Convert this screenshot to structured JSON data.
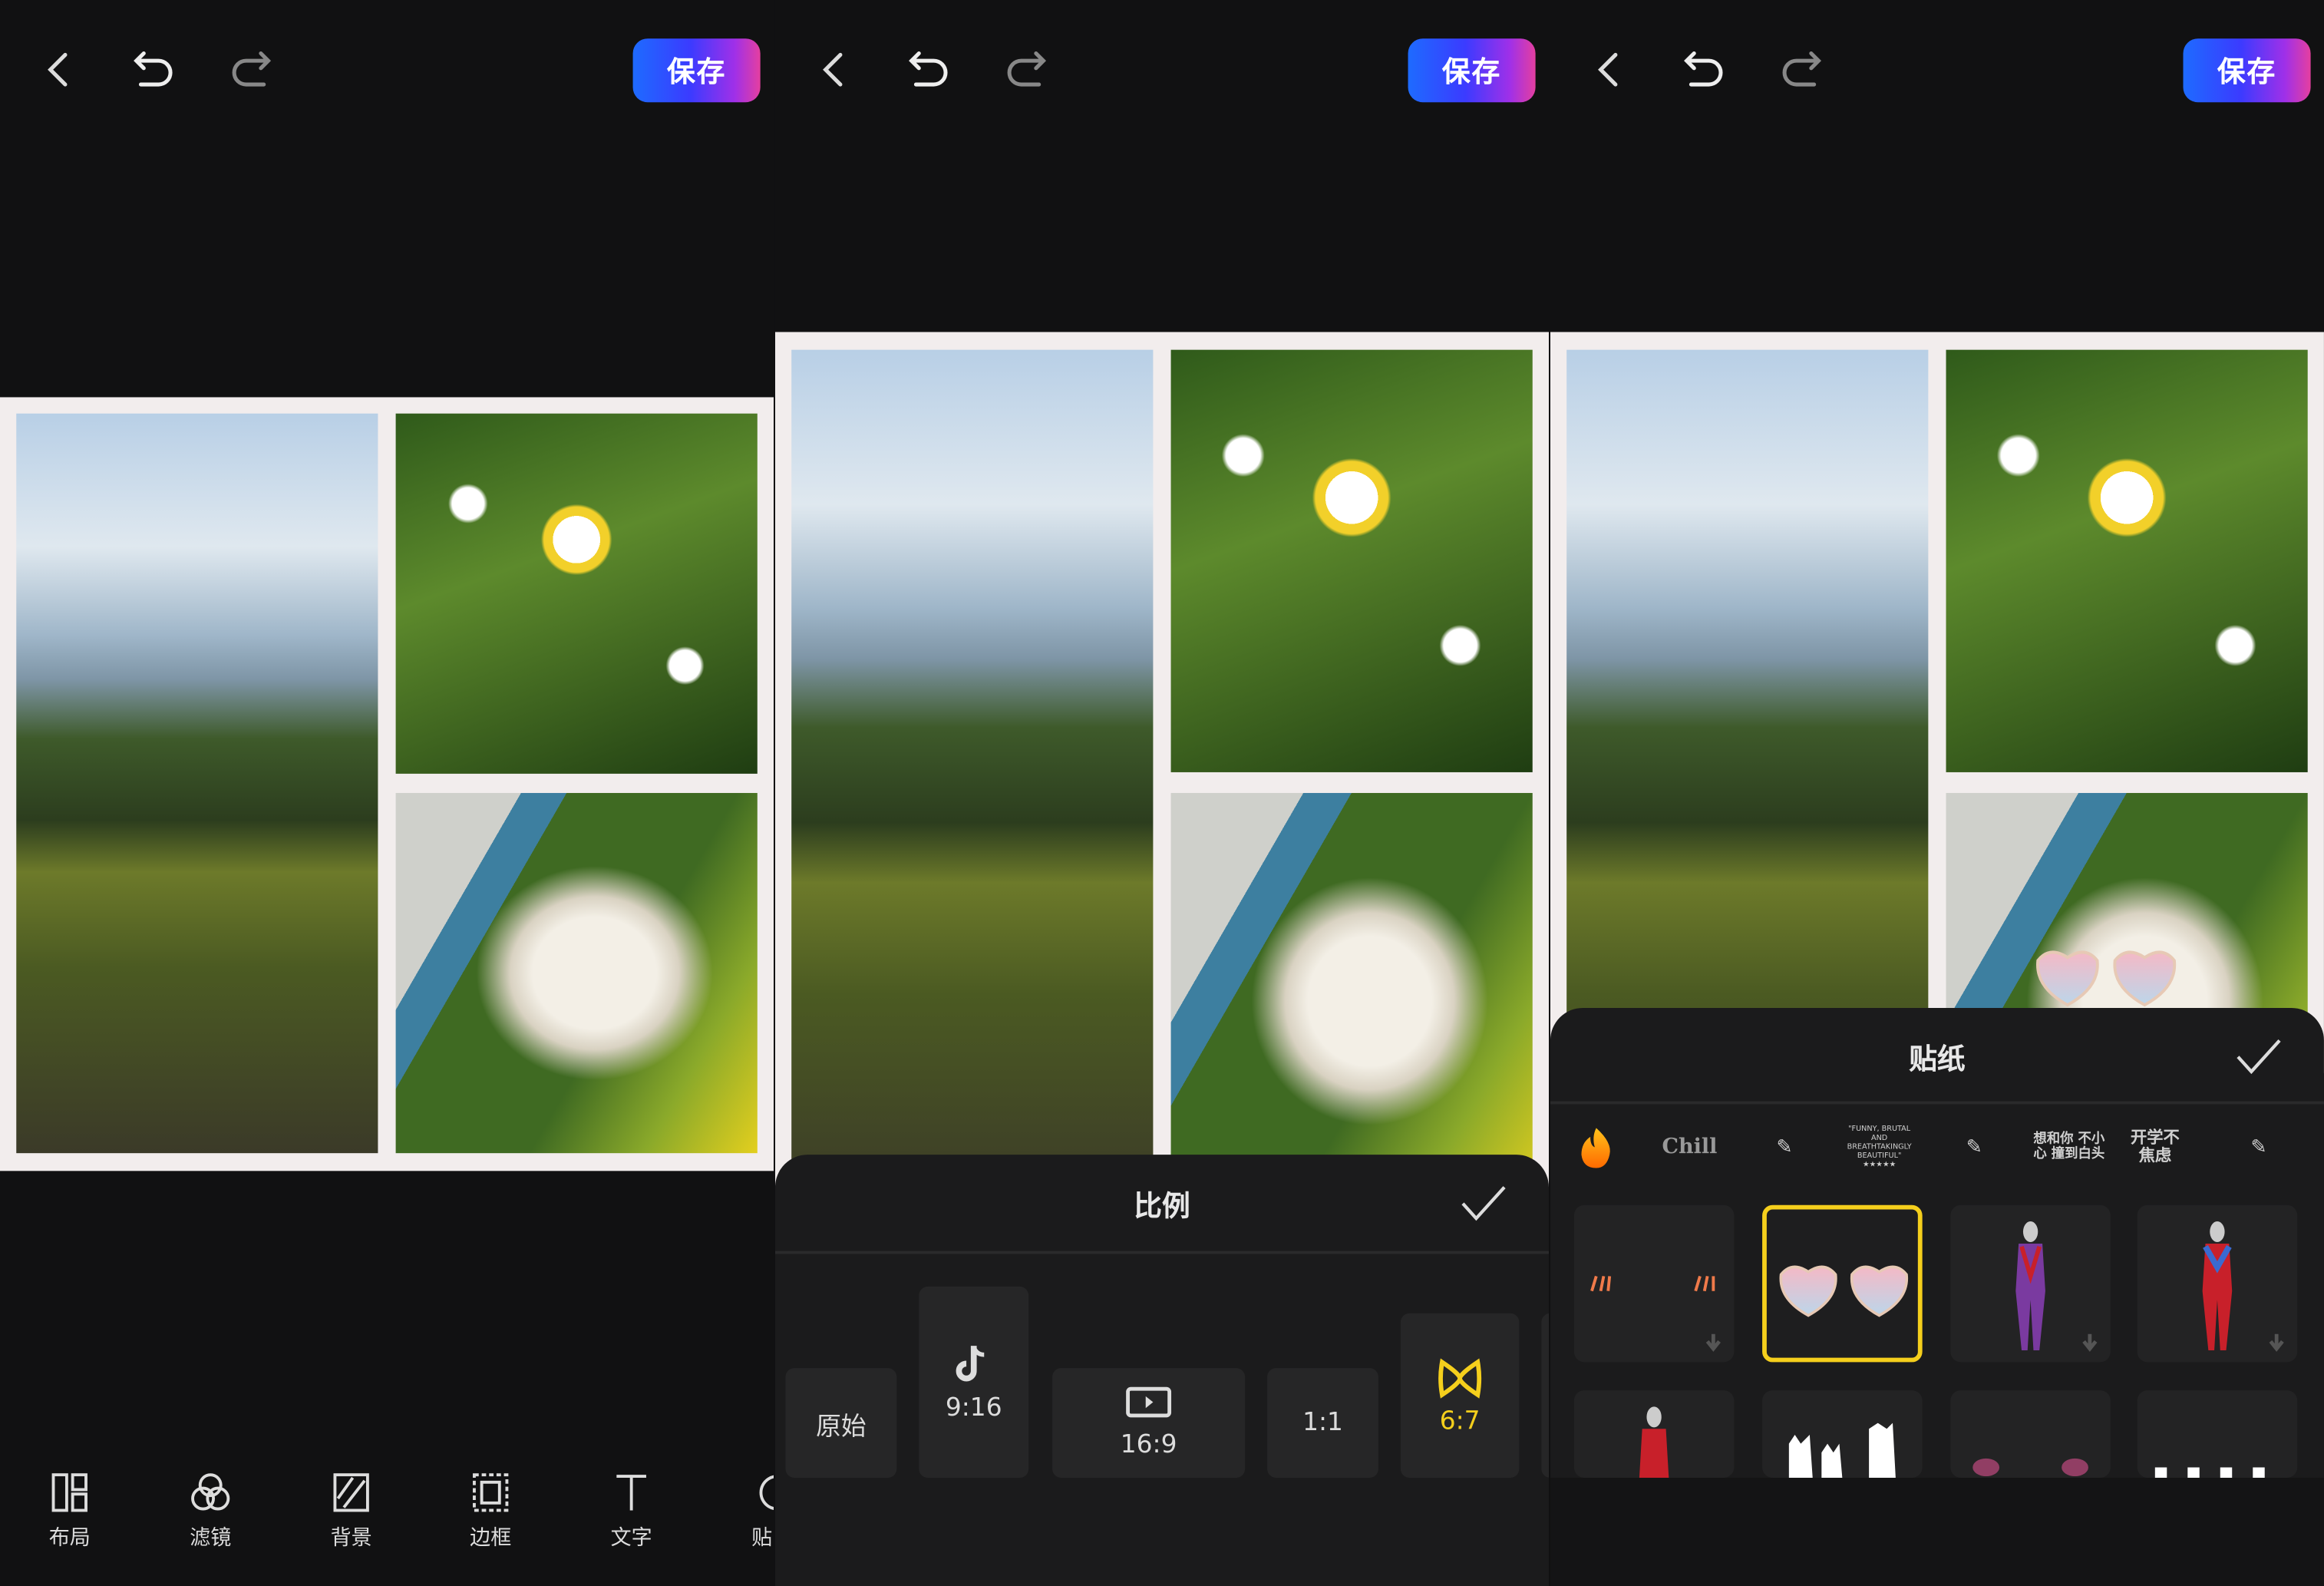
{
  "common": {
    "save_label": "保存"
  },
  "panel1": {
    "toolbar": [
      {
        "icon": "layout-icon",
        "label": "布局"
      },
      {
        "icon": "filter-icon",
        "label": "滤镜"
      },
      {
        "icon": "background-icon",
        "label": "背景"
      },
      {
        "icon": "border-icon",
        "label": "边框"
      },
      {
        "icon": "text-icon",
        "label": "文字"
      },
      {
        "icon": "sticker-icon",
        "label": "贴"
      }
    ]
  },
  "panel2": {
    "sheet_title": "比例",
    "ratios": [
      {
        "label": "原始",
        "icon": null
      },
      {
        "label": "9:16",
        "icon": "tiktok-icon"
      },
      {
        "label": "16:9",
        "icon": "video-play-icon"
      },
      {
        "label": "1:1",
        "icon": null
      },
      {
        "label": "6:7",
        "icon": "infinity-icon",
        "selected": true
      }
    ],
    "accent": "#f5cf1c"
  },
  "panel3": {
    "sheet_title": "贴纸",
    "categories": [
      {
        "icon": "fire-icon"
      },
      {
        "icon": "chill-icon",
        "text": "Chill"
      },
      {
        "icon": "handwriting-sticker-1"
      },
      {
        "icon": "review-sticker",
        "text": "\"FUNNY, BRUTAL AND BREATHTAKINGLY BEAUTIFUL\" ★★★★★"
      },
      {
        "icon": "handwriting-sticker-2"
      },
      {
        "icon": "text-sticker",
        "text": "想和你 不小心 撞到白头"
      },
      {
        "icon": "text-sticker",
        "text": "开学不 焦虑"
      },
      {
        "icon": "handwriting-sticker-3"
      }
    ],
    "stickers": [
      {
        "name": "blush-marks-sticker",
        "downloadable": true
      },
      {
        "name": "heart-glasses-sticker",
        "selected": true
      },
      {
        "name": "ultraman-sticker-1",
        "downloadable": true
      },
      {
        "name": "ultraman-sticker-2",
        "downloadable": true
      },
      {
        "name": "ultraman-sticker-3"
      },
      {
        "name": "cats-sticker"
      },
      {
        "name": "pink-blush-sticker"
      },
      {
        "name": "cats-row-sticker"
      }
    ]
  }
}
